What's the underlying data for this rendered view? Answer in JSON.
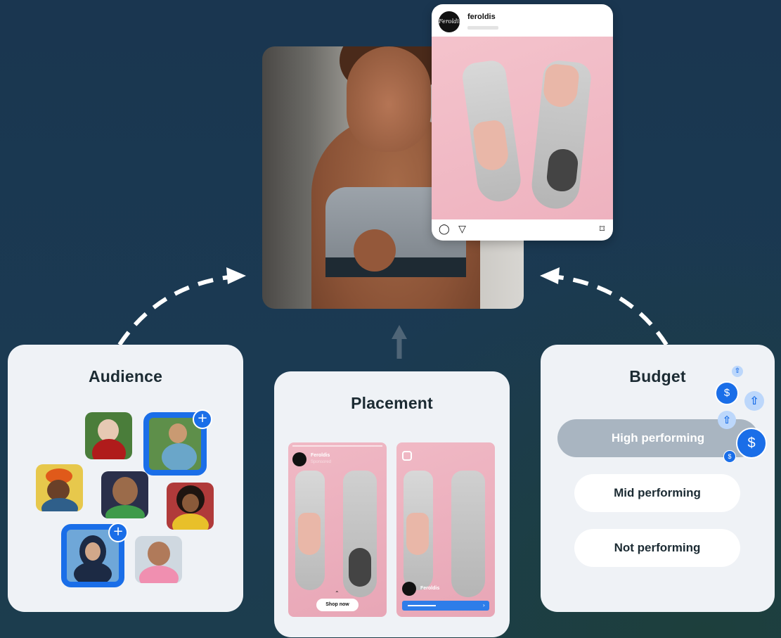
{
  "instagram_post": {
    "logo_text": "Feroldis",
    "account_name": "feroldis",
    "icons": [
      "comment-icon",
      "share-icon",
      "bookmark-icon"
    ]
  },
  "cards": {
    "audience": {
      "title": "Audience"
    },
    "placement": {
      "title": "Placement",
      "story": {
        "account": "Feroldis",
        "subtitle": "Sponsored",
        "cta": "Shop now"
      },
      "reel": {
        "account": "Feroldis"
      }
    },
    "budget": {
      "title": "Budget",
      "tiers": [
        "High performing",
        "Mid performing",
        "Not performing"
      ]
    }
  },
  "colors": {
    "background": "#1b3a52",
    "card": "#eff2f6",
    "accent": "#1a6ee8",
    "high_pill": "#a9b5c1"
  }
}
